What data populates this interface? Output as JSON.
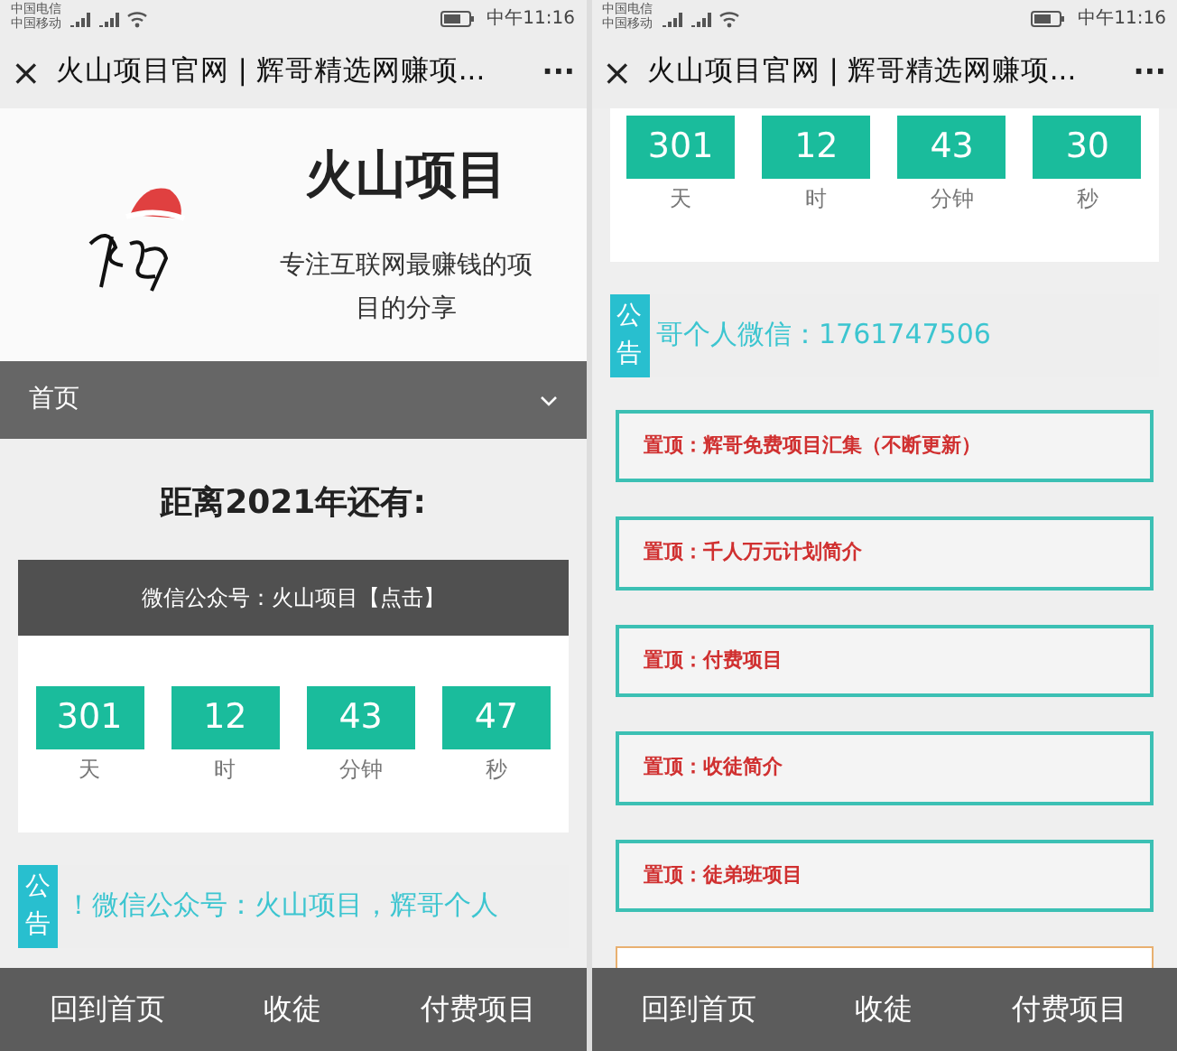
{
  "screens": [
    {
      "status_bar": {
        "carriers": [
          "中国电信",
          "中国移动"
        ],
        "time": "中午11:16"
      },
      "title_bar": {
        "close": "×",
        "title": "火山项目官网 | 辉哥精选网赚项...",
        "more": "···"
      },
      "sections": [
        {
          "kind": "header",
          "title": "火山项目",
          "subtitle": "专注互联网最赚钱的项目的分享"
        },
        {
          "kind": "nav",
          "label": "首页",
          "expanded": false
        },
        {
          "kind": "heading",
          "text": "距离2021年还有:"
        },
        {
          "kind": "countdown",
          "header": "微信公众号：火山项目【点击】",
          "units": [
            {
              "value": "301",
              "label": "天"
            },
            {
              "value": "12",
              "label": "时"
            },
            {
              "value": "43",
              "label": "分钟"
            },
            {
              "value": "47",
              "label": "秒"
            }
          ]
        },
        {
          "kind": "notice",
          "badge": "公告",
          "text": "！微信公众号：火山项目，辉哥个人"
        }
      ],
      "bottom_nav": [
        "回到首页",
        "收徒",
        "付费项目"
      ]
    },
    {
      "status_bar": {
        "carriers": [
          "中国电信",
          "中国移动"
        ],
        "time": "中午11:16"
      },
      "title_bar": {
        "close": "×",
        "title": "火山项目官网 | 辉哥精选网赚项...",
        "more": "···"
      },
      "sections": [
        {
          "kind": "countdown",
          "units": [
            {
              "value": "301",
              "label": "天"
            },
            {
              "value": "12",
              "label": "时"
            },
            {
              "value": "43",
              "label": "分钟"
            },
            {
              "value": "30",
              "label": "秒"
            }
          ]
        },
        {
          "kind": "notice",
          "badge": "公告",
          "text": "哥个人微信：1761747506"
        },
        {
          "kind": "pinned",
          "items": [
            "置顶：辉哥免费项目汇集（不断更新）",
            "置顶：千人万元计划简介",
            "置顶：付费项目",
            "置顶：收徒简介",
            "置顶：徒弟班项目"
          ]
        },
        {
          "kind": "search"
        }
      ],
      "bottom_nav": [
        "回到首页",
        "收徒",
        "付费项目"
      ]
    }
  ]
}
